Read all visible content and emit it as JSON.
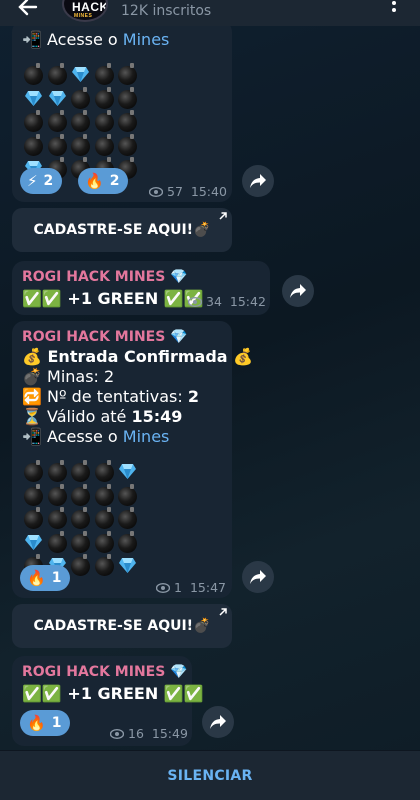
{
  "header": {
    "channel_logo": {
      "top": "HACK",
      "bottom": "MINES"
    },
    "subscribers": "12K inscritos"
  },
  "messages": [
    {
      "line_open": "Acesse o ",
      "link": "Mines",
      "grid": [
        [
          "bomb",
          "bomb",
          "gem",
          "bomb",
          "bomb"
        ],
        [
          "gem",
          "gem",
          "bomb",
          "bomb",
          "bomb"
        ],
        [
          "bomb",
          "bomb",
          "bomb",
          "bomb",
          "bomb"
        ],
        [
          "bomb",
          "bomb",
          "bomb",
          "bomb",
          "bomb"
        ],
        [
          "gem",
          "bomb",
          "bomb",
          "bomb",
          "bomb"
        ]
      ],
      "reactions": [
        {
          "emoji": "⚡",
          "count": "2"
        },
        {
          "emoji": "🔥",
          "count": "2"
        }
      ],
      "views": "57",
      "time": "15:40"
    },
    {
      "sender": "ROGI HACK MINES",
      "text": "+1 GREEN",
      "views": "34",
      "time": "15:42"
    },
    {
      "sender": "ROGI HACK MINES",
      "entry": "Entrada Confirmada",
      "mines": "Minas: 2",
      "attempts_label": "Nº de tentativas: ",
      "attempts_value": "2",
      "valid_label": "Válido até ",
      "valid_value": "15:49",
      "line_open": "Acesse o ",
      "link": "Mines",
      "grid": [
        [
          "bomb",
          "bomb",
          "bomb",
          "bomb",
          "gem"
        ],
        [
          "bomb",
          "bomb",
          "bomb",
          "bomb",
          "bomb"
        ],
        [
          "bomb",
          "bomb",
          "bomb",
          "bomb",
          "bomb"
        ],
        [
          "gem",
          "bomb",
          "bomb",
          "bomb",
          "bomb"
        ],
        [
          "bomb",
          "gem",
          "bomb",
          "bomb",
          "gem"
        ]
      ],
      "reactions": [
        {
          "emoji": "🔥",
          "count": "1"
        }
      ],
      "views": "1",
      "time": "15:47"
    },
    {
      "sender": "ROGI HACK MINES",
      "text": "+1 GREEN",
      "reactions": [
        {
          "emoji": "🔥",
          "count": "1"
        }
      ],
      "views": "16",
      "time": "15:49"
    }
  ],
  "buttons": [
    {
      "label": "CADASTRE-SE AQUI!"
    },
    {
      "label": "CADASTRE-SE AQUI!"
    }
  ],
  "footer": {
    "silence_label": "SILENCIAR"
  },
  "colors": {
    "accent": "#6ab3f3",
    "sender": "#e3779d",
    "bubble": "#182533",
    "reaction": "#5a9bd6"
  }
}
